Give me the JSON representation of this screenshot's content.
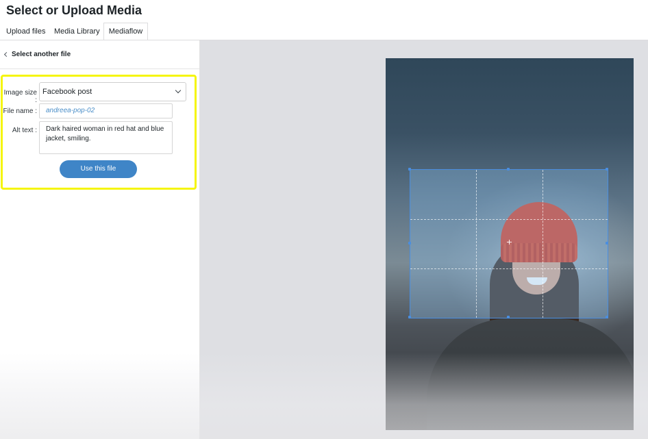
{
  "modal": {
    "title": "Select or Upload Media"
  },
  "tabs": [
    {
      "label": "Upload files"
    },
    {
      "label": "Media Library"
    },
    {
      "label": "Mediaflow",
      "active": true
    }
  ],
  "sidebar": {
    "back_label": "Select another file",
    "form": {
      "image_size_label": "Image size :",
      "image_size_value": "Facebook post",
      "file_name_label": "File name :",
      "file_name_value": "andreea-pop-02",
      "alt_text_label": "Alt text :",
      "alt_text_value": "Dark haired woman in red hat and blue jacket, smiling.",
      "submit_label": "Use this file"
    }
  },
  "colors": {
    "highlight": "#f5f50a",
    "primary_button": "#3f85c7",
    "crop_border": "#4a8ee0",
    "file_name_text": "#4a8ec8"
  },
  "icons": {
    "back": "chevron-left-icon",
    "select": "chevron-down-icon"
  }
}
